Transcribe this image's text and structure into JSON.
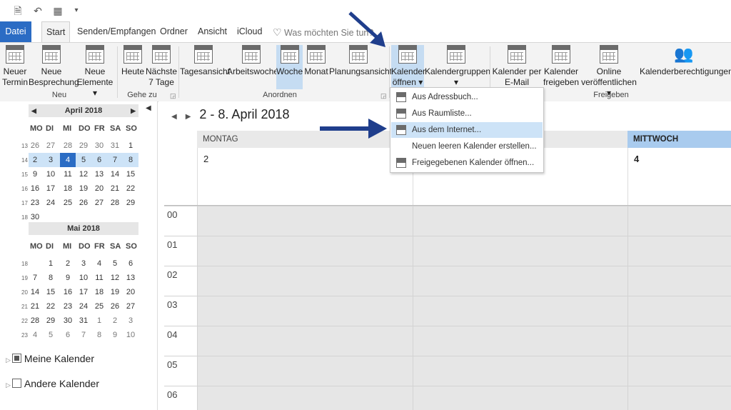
{
  "tabs": [
    "Datei",
    "Start",
    "Senden/Empfangen",
    "Ordner",
    "Ansicht",
    "iCloud"
  ],
  "tellme_placeholder": "Was möchten Sie tun?",
  "ribbon": {
    "new_appointment": [
      "Neuer",
      "Termin"
    ],
    "new_meeting": [
      "Neue",
      "Besprechung"
    ],
    "new_items": [
      "Neue",
      "Elemente ▾"
    ],
    "today": "Heute",
    "next7": [
      "Nächste",
      "7 Tage"
    ],
    "day_view": "Tagesansicht",
    "work_week": "Arbeitswoche",
    "week": "Woche",
    "month": "Monat",
    "schedule_view": "Planungsansicht",
    "open_calendar": [
      "Kalender",
      "öffnen ▾"
    ],
    "calendar_groups": [
      "Kalendergruppen",
      "▾"
    ],
    "email_calendar": [
      "Kalender per",
      "E-Mail senden"
    ],
    "share_calendar": [
      "Kalender",
      "freigeben"
    ],
    "publish_online": [
      "Online",
      "veröffentlichen ▾"
    ],
    "calendar_permissions": "Kalenderberechtigungen",
    "groups": {
      "new": "Neu",
      "goto": "Gehe zu",
      "arrange": "Anordnen",
      "share": "Freigeben"
    }
  },
  "dropdown": [
    "Aus Adressbuch...",
    "Aus Raumliste...",
    "Aus dem Internet...",
    "Neuen leeren Kalender erstellen...",
    "Freigegebenen Kalender öffnen..."
  ],
  "april": {
    "title": "April 2018",
    "dow": [
      "MO",
      "DI",
      "MI",
      "DO",
      "FR",
      "SA",
      "SO"
    ],
    "weeks": [
      {
        "wk": "13",
        "days": [
          "26",
          "27",
          "28",
          "29",
          "30",
          "31",
          "1"
        ]
      },
      {
        "wk": "14",
        "days": [
          "2",
          "3",
          "4",
          "5",
          "6",
          "7",
          "8"
        ]
      },
      {
        "wk": "15",
        "days": [
          "9",
          "10",
          "11",
          "12",
          "13",
          "14",
          "15"
        ]
      },
      {
        "wk": "16",
        "days": [
          "16",
          "17",
          "18",
          "19",
          "20",
          "21",
          "22"
        ]
      },
      {
        "wk": "17",
        "days": [
          "23",
          "24",
          "25",
          "26",
          "27",
          "28",
          "29"
        ]
      },
      {
        "wk": "18",
        "days": [
          "30",
          "",
          "",
          "",
          "",
          "",
          ""
        ]
      }
    ]
  },
  "may": {
    "title": "Mai 2018",
    "dow": [
      "MO",
      "DI",
      "MI",
      "DO",
      "FR",
      "SA",
      "SO"
    ],
    "weeks": [
      {
        "wk": "18",
        "days": [
          "",
          "1",
          "2",
          "3",
          "4",
          "5",
          "6"
        ]
      },
      {
        "wk": "19",
        "days": [
          "7",
          "8",
          "9",
          "10",
          "11",
          "12",
          "13"
        ]
      },
      {
        "wk": "20",
        "days": [
          "14",
          "15",
          "16",
          "17",
          "18",
          "19",
          "20"
        ]
      },
      {
        "wk": "21",
        "days": [
          "21",
          "22",
          "23",
          "24",
          "25",
          "26",
          "27"
        ]
      },
      {
        "wk": "22",
        "days": [
          "28",
          "29",
          "30",
          "31",
          "1",
          "2",
          "3"
        ]
      },
      {
        "wk": "23",
        "days": [
          "4",
          "5",
          "6",
          "7",
          "8",
          "9",
          "10"
        ]
      }
    ]
  },
  "folders": [
    "Meine Kalender",
    "Andere Kalender"
  ],
  "date_range": "2 - 8. April 2018",
  "columns": [
    {
      "label": "MONTAG",
      "day": "2"
    },
    {
      "label": "MITTWOCH",
      "day": "4"
    }
  ],
  "hours": [
    "00",
    "01",
    "02",
    "03",
    "04",
    "05",
    "06"
  ],
  "colors": {
    "accent": "#2b6cc4",
    "selected": "#cde3f7",
    "arrow": "#1f3e8c"
  }
}
